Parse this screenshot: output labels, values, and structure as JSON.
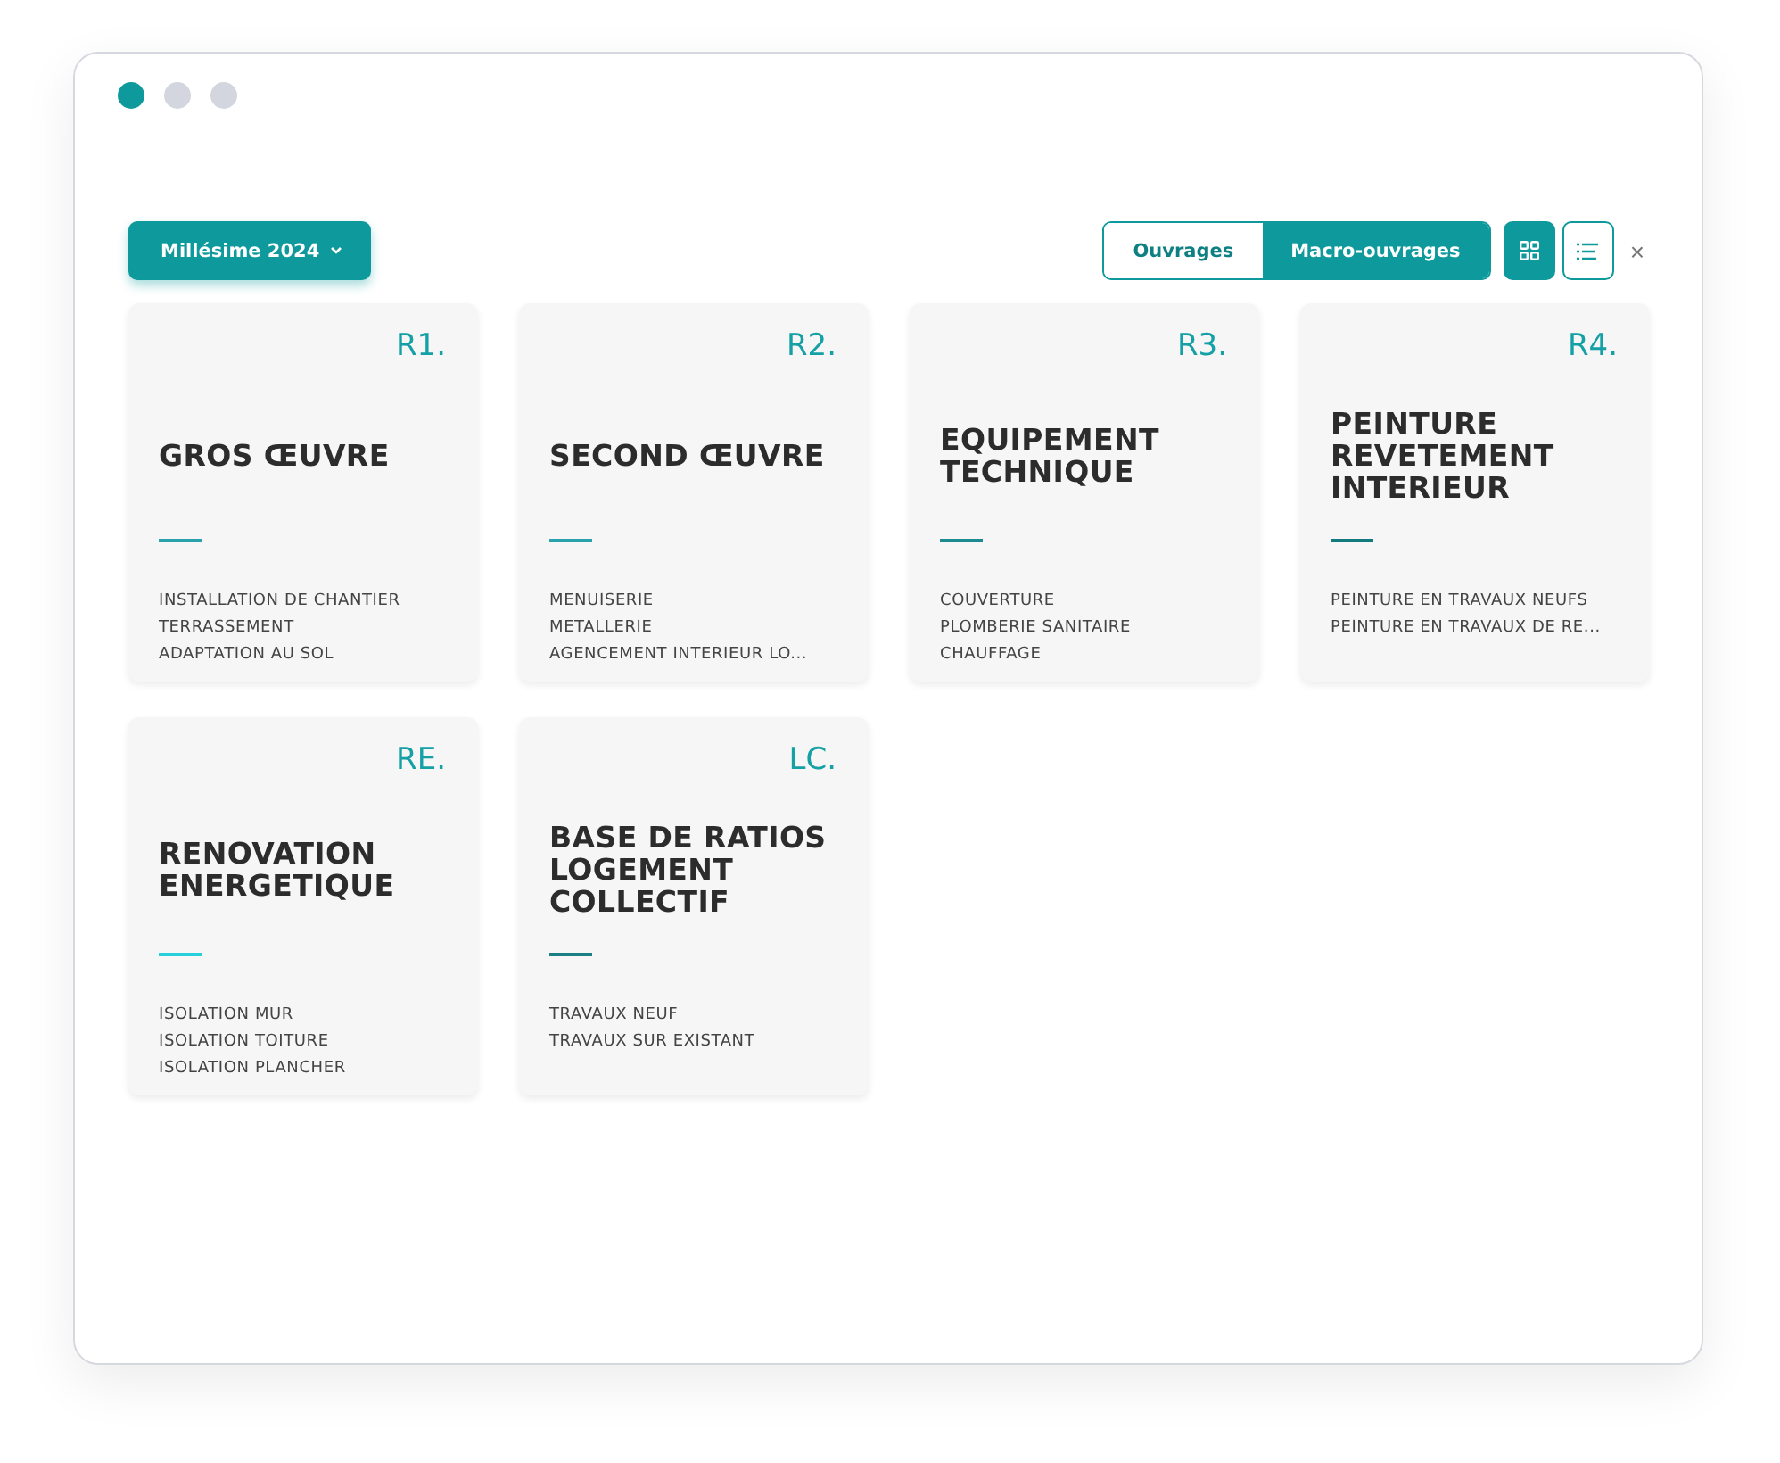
{
  "window": {
    "dots": [
      {
        "color": "#0e9a9c"
      },
      {
        "color": "#d3d6de"
      },
      {
        "color": "#d3d6de"
      }
    ]
  },
  "toolbar": {
    "dropdown": {
      "label": "Millésime 2024"
    },
    "segments": [
      {
        "label": "Ouvrages",
        "selected": false
      },
      {
        "label": "Macro-ouvrages",
        "selected": true
      }
    ],
    "views": [
      {
        "kind": "grid",
        "selected": true
      },
      {
        "kind": "list",
        "selected": false
      }
    ],
    "close": "×"
  },
  "cards": [
    {
      "code": "R1.",
      "title": "GROS ŒUVRE",
      "color": "#29a3ab",
      "items": [
        "INSTALLATION DE CHANTIER",
        "TERRASSEMENT",
        "ADAPTATION AU SOL"
      ]
    },
    {
      "code": "R2.",
      "title": "SECOND ŒUVRE",
      "color": "#29a3ab",
      "items": [
        "MENUISERIE",
        "METALLERIE",
        "AGENCEMENT INTERIEUR LO..."
      ]
    },
    {
      "code": "R3.",
      "title": "EQUIPEMENT TECHNIQUE",
      "color": "#1d8a8f",
      "items": [
        "COUVERTURE",
        "PLOMBERIE SANITAIRE",
        "CHAUFFAGE"
      ]
    },
    {
      "code": "R4.",
      "title": "PEINTURE REVETEMENT INTERIEUR",
      "color": "#137a7d",
      "items": [
        "PEINTURE EN TRAVAUX NEUFS",
        "PEINTURE EN TRAVAUX DE RE..."
      ]
    },
    {
      "code": "RE.",
      "title": "RENOVATION ENERGETIQUE",
      "color": "#28d0dc",
      "items": [
        "ISOLATION MUR",
        "ISOLATION TOITURE",
        "ISOLATION PLANCHER"
      ]
    },
    {
      "code": "LC.",
      "title": "BASE DE RATIOS LOGEMENT COLLECTIF",
      "color": "#1b7f84",
      "items": [
        "TRAVAUX NEUF",
        "TRAVAUX SUR EXISTANT"
      ]
    }
  ]
}
